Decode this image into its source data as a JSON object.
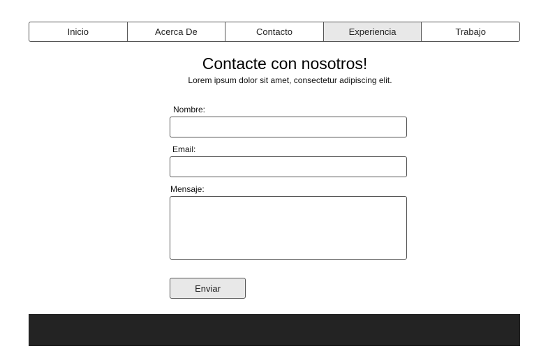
{
  "nav": {
    "items": [
      {
        "label": "Inicio",
        "active": false
      },
      {
        "label": "Acerca De",
        "active": false
      },
      {
        "label": "Contacto",
        "active": false
      },
      {
        "label": "Experiencia",
        "active": true
      },
      {
        "label": "Trabajo",
        "active": false
      }
    ]
  },
  "page": {
    "title": "Contacte con nosotros!",
    "subtitle": "Lorem ipsum dolor sit amet, consectetur adipiscing elit."
  },
  "form": {
    "name_label": "Nombre:",
    "name_value": "",
    "email_label": "Email:",
    "email_value": "",
    "message_label": "Mensaje:",
    "message_value": "",
    "submit_label": "Enviar"
  },
  "colors": {
    "active_tab_bg": "#e8e8e8",
    "footer_bg": "#232323",
    "border": "#555555"
  }
}
